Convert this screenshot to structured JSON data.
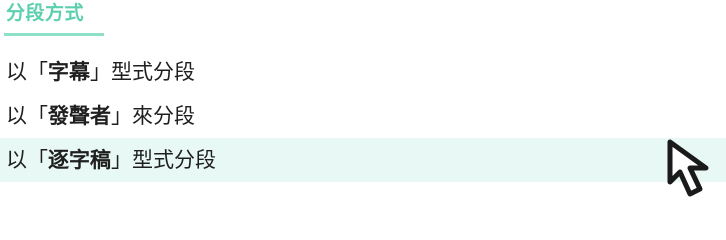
{
  "section": {
    "title": "分段方式"
  },
  "options": [
    {
      "prefix": "以「",
      "keyword": "字幕",
      "suffix": "」型式分段",
      "selected": false
    },
    {
      "prefix": "以「",
      "keyword": "發聲者",
      "suffix": "」來分段",
      "selected": false
    },
    {
      "prefix": "以「",
      "keyword": "逐字稿",
      "suffix": "」型式分段",
      "selected": true
    }
  ],
  "colors": {
    "accent": "#5ccfae",
    "underline": "#8fe0c9",
    "selected_bg": "#e8f8f4",
    "text": "#1f1f1f"
  },
  "icons": {
    "cursor": "mouse-pointer-icon"
  }
}
